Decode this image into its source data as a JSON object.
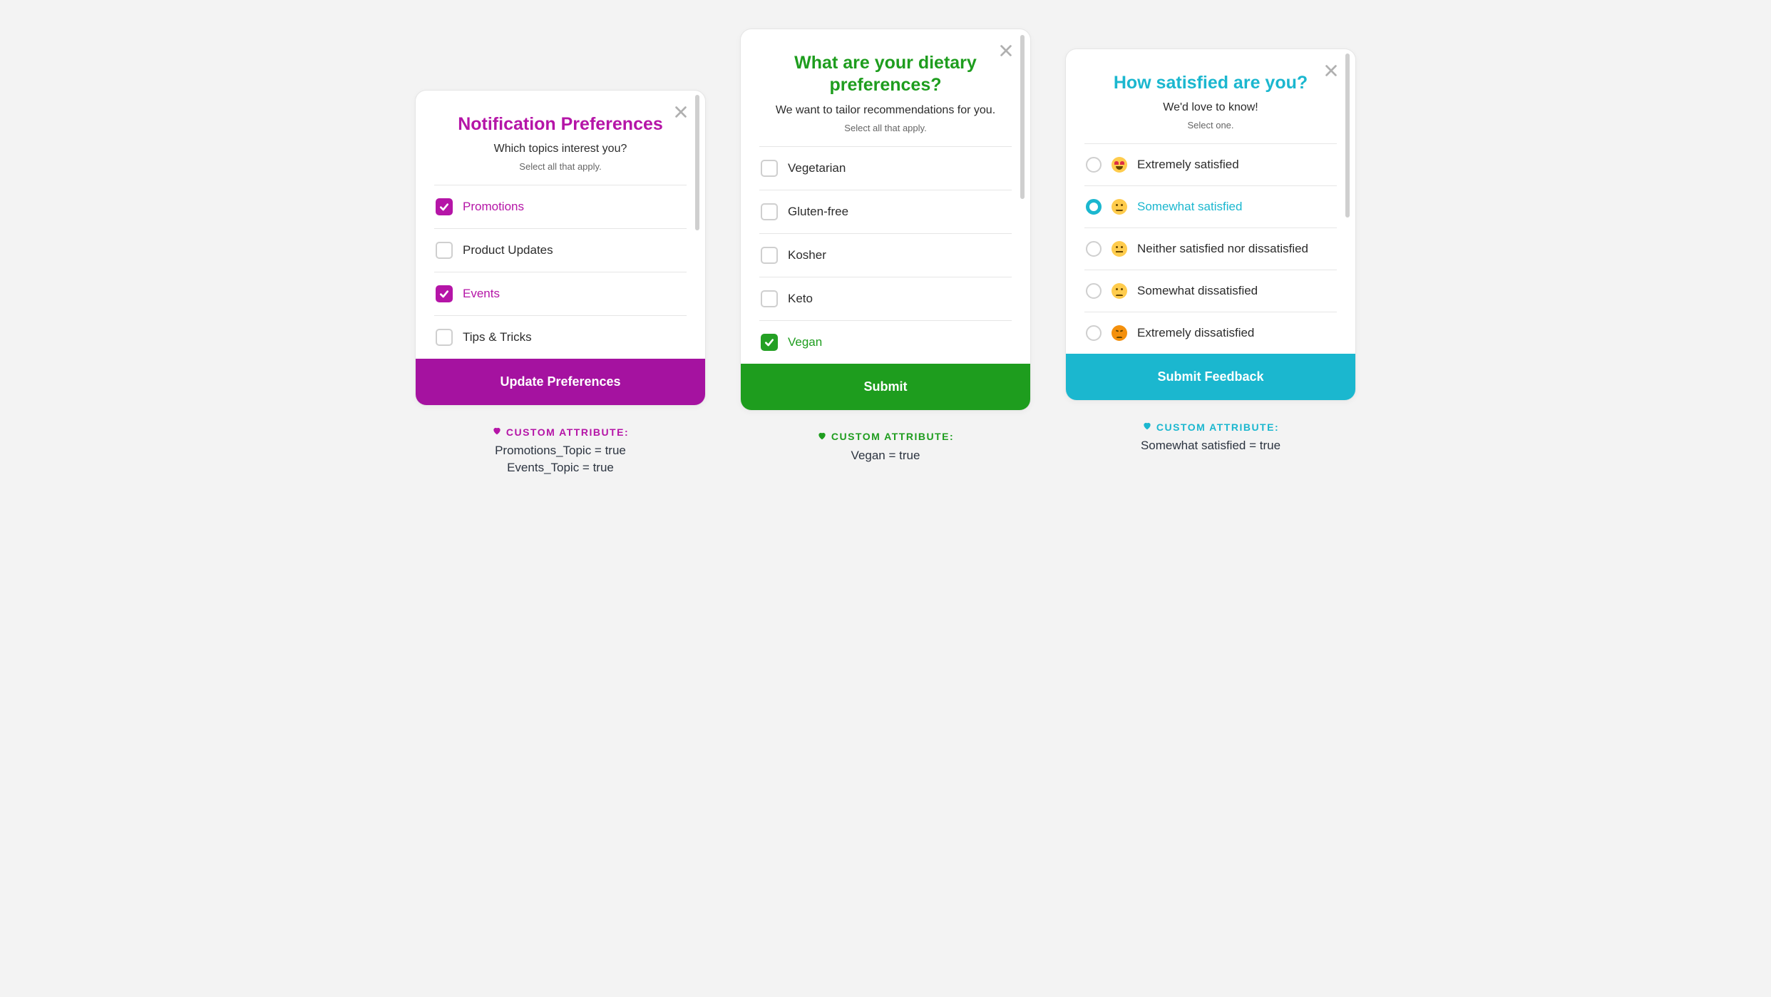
{
  "cards": [
    {
      "title": "Notification Preferences",
      "subtitle": "Which topics interest you?",
      "note": "Select all that apply.",
      "button": "Update Preferences",
      "options": [
        {
          "label": "Promotions",
          "checked": true
        },
        {
          "label": "Product Updates",
          "checked": false
        },
        {
          "label": "Events",
          "checked": true
        },
        {
          "label": "Tips & Tricks",
          "checked": false
        }
      ],
      "attr_label": "CUSTOM ATTRIBUTE:",
      "attr_lines": [
        "Promotions_Topic = true",
        "Events_Topic = true"
      ]
    },
    {
      "title": "What are your dietary preferences?",
      "subtitle": "We want to tailor recommendations for you.",
      "note": "Select all that apply.",
      "button": "Submit",
      "options": [
        {
          "label": "Vegetarian",
          "checked": false
        },
        {
          "label": "Gluten-free",
          "checked": false
        },
        {
          "label": "Kosher",
          "checked": false
        },
        {
          "label": "Keto",
          "checked": false
        },
        {
          "label": "Vegan",
          "checked": true
        }
      ],
      "attr_label": "CUSTOM ATTRIBUTE:",
      "attr_lines": [
        "Vegan = true"
      ]
    },
    {
      "title": "How satisfied are you?",
      "subtitle": "We'd love to know!",
      "note": "Select one.",
      "button": "Submit Feedback",
      "options": [
        {
          "label": "Extremely satisfied",
          "selected": false,
          "emoji": "heart-eyes"
        },
        {
          "label": "Somewhat satisfied",
          "selected": true,
          "emoji": "smile"
        },
        {
          "label": "Neither satisfied nor dissatisfied",
          "selected": false,
          "emoji": "neutral"
        },
        {
          "label": "Somewhat dissatisfied",
          "selected": false,
          "emoji": "sad"
        },
        {
          "label": "Extremely dissatisfied",
          "selected": false,
          "emoji": "angry"
        }
      ],
      "attr_label": "CUSTOM ATTRIBUTE:",
      "attr_lines": [
        "Somewhat satisfied = true"
      ]
    }
  ]
}
